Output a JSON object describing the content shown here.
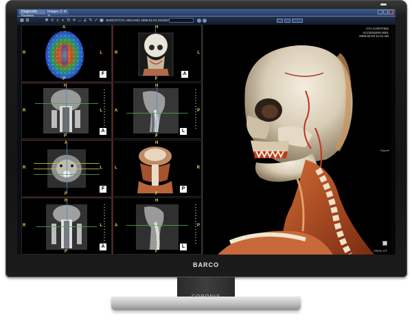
{
  "titlebar": {
    "tabs": [
      "Diagnostic Desktop",
      "Images (1 of 1)"
    ]
  },
  "toolbar": {
    "patient_info": "BARCO^CTA, MICHAEL  1956-01-01  S1234/A008"
  },
  "viewports": {
    "axial_perfusion": {
      "top": "A",
      "bottom": "P",
      "left": "R",
      "right": "L",
      "badge": "F"
    },
    "axial_head": {
      "top": "H",
      "bottom": "F",
      "left": "R",
      "right": "L",
      "badge": "A"
    },
    "coronal_neck": {
      "top": "H",
      "bottom": "F",
      "left": "R",
      "right": "L",
      "badge": "A"
    },
    "sagittal_neck": {
      "top": "H",
      "bottom": "F",
      "left": "A",
      "right": "P",
      "badge": "L"
    },
    "axial_slice": {
      "top": "A",
      "bottom": "P",
      "left": "R",
      "right": "L",
      "badge": "F"
    },
    "coronal_3d": {
      "top": "H",
      "bottom": "F",
      "left": "L",
      "right": "R",
      "badge": "P"
    },
    "coronal_spine": {
      "top": "H",
      "bottom": "F",
      "left": "R",
      "right": "L",
      "badge": "A"
    },
    "sagittal_spine": {
      "top": "H",
      "bottom": "F",
      "left": "A",
      "right": "P",
      "badge": "L"
    }
  },
  "volume_render": {
    "info_lines": [
      "CTA CAROTIDS",
      "ACCESSION 0001",
      "2009-03-03 11:01 AM"
    ],
    "footer": "AXIAL CT",
    "side_label": "Clipped"
  },
  "monitor": {
    "brand": "BARCO",
    "model": "CORONIS"
  },
  "colors": {
    "orientation_marker": "#f0d85a",
    "titlebar": "#3d5a8a",
    "reference_line_green": "#49a85a",
    "reference_line_red": "#c23232"
  }
}
